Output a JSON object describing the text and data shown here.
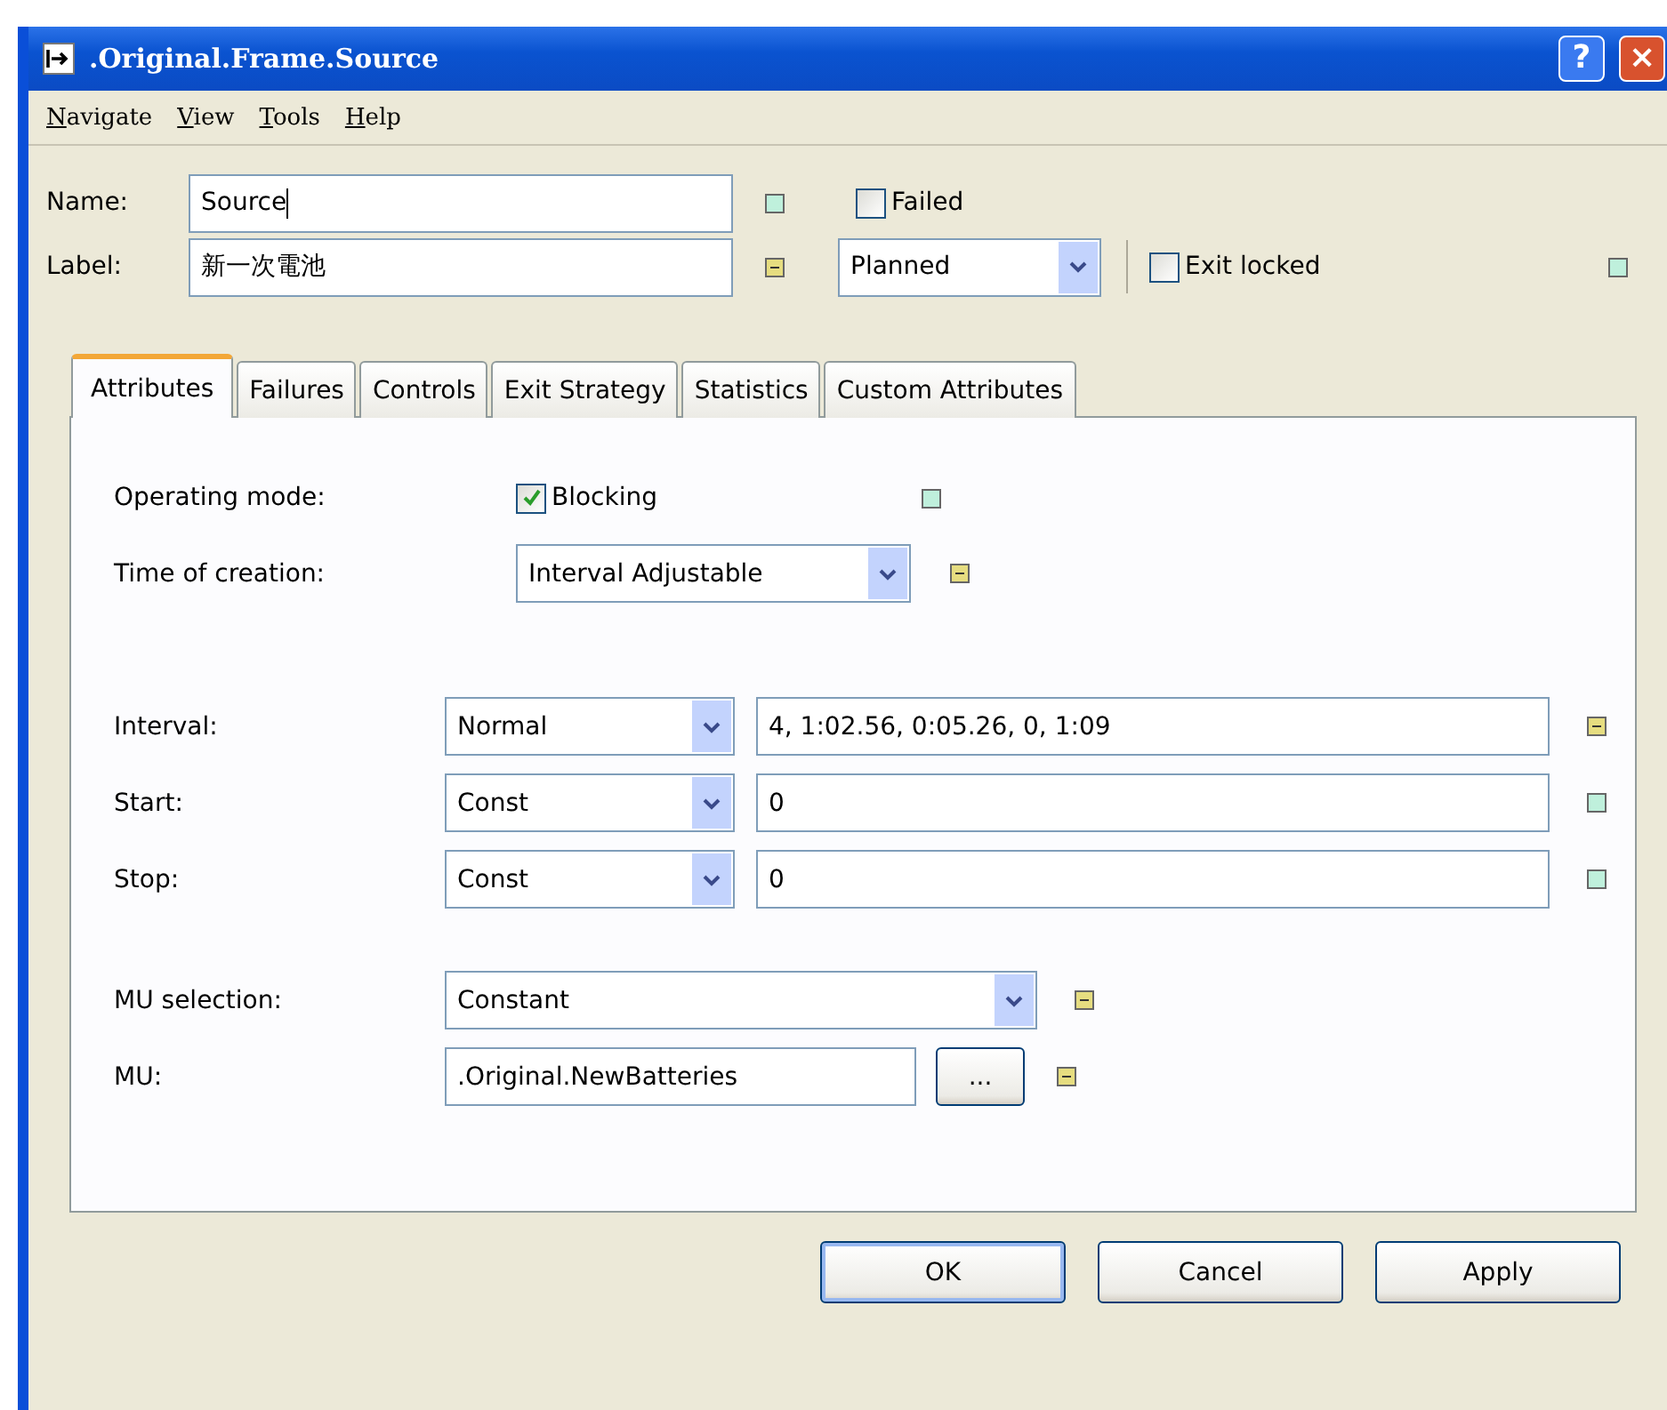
{
  "window": {
    "title": ".Original.Frame.Source",
    "help_button": "?",
    "close_button": "×"
  },
  "menu": [
    {
      "label": "Navigate"
    },
    {
      "label": "View"
    },
    {
      "label": "Tools"
    },
    {
      "label": "Help"
    }
  ],
  "header": {
    "name_label": "Name:",
    "name_value": "Source",
    "name_inherited": true,
    "failed": {
      "label": "Failed",
      "checked": false
    },
    "label_label": "Label:",
    "label_value": "新一次電池",
    "label_inherited": false,
    "plan_value": "Planned",
    "exit_locked": {
      "label": "Exit locked",
      "checked": false
    },
    "exit_inherited": true
  },
  "tabs": [
    {
      "label": "Attributes",
      "selected": true
    },
    {
      "label": "Failures",
      "selected": false
    },
    {
      "label": "Controls",
      "selected": false
    },
    {
      "label": "Exit Strategy",
      "selected": false
    },
    {
      "label": "Statistics",
      "selected": false
    },
    {
      "label": "Custom Attributes",
      "selected": false
    }
  ],
  "attributes": {
    "operating_mode": {
      "label": "Operating mode:",
      "checkbox": "Blocking",
      "checked": true,
      "inherited": true
    },
    "time_of_creation": {
      "label": "Time of creation:",
      "value": "Interval Adjustable",
      "inherited": false
    },
    "rows": [
      {
        "label": "Interval:",
        "distribution": "Normal",
        "value": "4, 1:02.56, 0:05.26, 0, 1:09",
        "inherited": false
      },
      {
        "label": "Start:",
        "distribution": "Const",
        "value": "0",
        "inherited": true
      },
      {
        "label": "Stop:",
        "distribution": "Const",
        "value": "0",
        "inherited": true
      }
    ],
    "mu_selection": {
      "label": "MU selection:",
      "value": "Constant",
      "inherited": false
    },
    "mu": {
      "label": "MU:",
      "value": ".Original.NewBatteries",
      "browse": "...",
      "inherited": false
    }
  },
  "buttons": [
    {
      "label": "OK",
      "default": true
    },
    {
      "label": "Cancel",
      "default": false
    },
    {
      "label": "Apply",
      "default": false
    }
  ]
}
